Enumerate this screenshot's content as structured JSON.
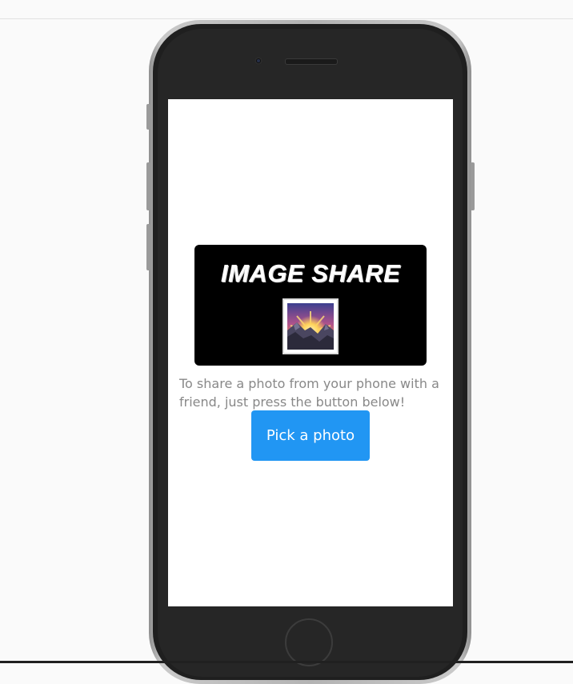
{
  "app": {
    "hero_title": "IMAGE SHARE",
    "description": "To share a photo from your phone with a friend, just press the button below!",
    "pick_button_label": "Pick a photo"
  },
  "icons": {
    "hero_image": "sunrise-over-mountains-icon"
  },
  "colors": {
    "button": "#2196f3",
    "description_text": "#888888",
    "hero_background": "#000000",
    "screen_background": "#ffffff",
    "phone_body": "#262626"
  }
}
